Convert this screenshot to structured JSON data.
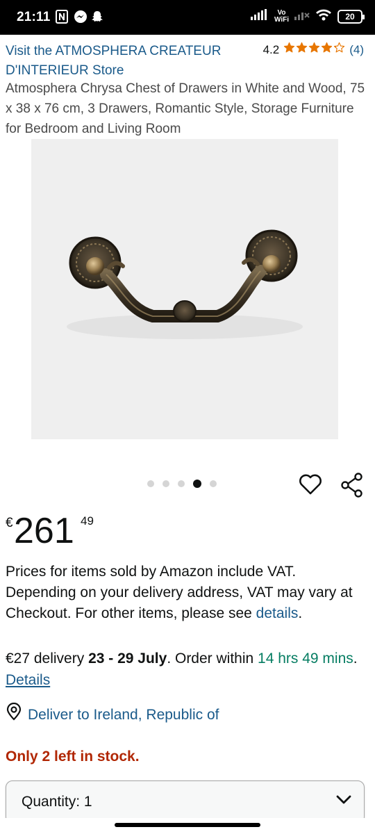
{
  "status_bar": {
    "time": "21:11",
    "vowifi_top": "Vo",
    "vowifi_bottom": "WiFi",
    "battery": "20"
  },
  "header": {
    "store_link": "Visit the ATMOSPHERA CREATEUR D'INTERIEUR Store",
    "rating_value": "4.2",
    "rating_count": "(4)",
    "stars_filled": 4.2
  },
  "product": {
    "title": "Atmosphera Chrysa Chest of Drawers in White and Wood, 75 x 38 x 76 cm, 3 Drawers, Romantic Style, Storage Furniture for Bedroom and Living Room",
    "image_icon": "drawer-handle-image",
    "carousel_count": 5,
    "carousel_active": 4
  },
  "price": {
    "currency": "€",
    "whole": "261",
    "fraction": "49"
  },
  "vat": {
    "text": "Prices for items sold by Amazon include VAT. Depending on your delivery address, VAT may vary at Checkout. For other items, please see ",
    "details_link": "details",
    "after": "."
  },
  "delivery": {
    "cost": "€27 delivery ",
    "dates": "23 - 29 July",
    "order_within": ". Order within ",
    "countdown": "14 hrs 49 mins",
    "separator": ". ",
    "details_link": "Details"
  },
  "deliver_to": {
    "text": "Deliver to Ireland, Republic of",
    "icon": "location-pin-icon"
  },
  "stock": {
    "text": "Only 2 left in stock."
  },
  "quantity": {
    "label": "Quantity: 1"
  },
  "colors": {
    "link": "#1a5a8a",
    "green": "#067d62",
    "stock_red": "#b12704",
    "star": "#e77600"
  }
}
